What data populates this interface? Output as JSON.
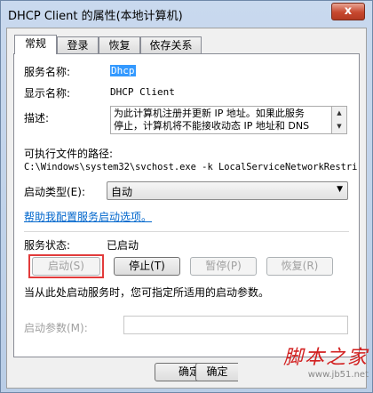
{
  "window": {
    "title": "DHCP Client 的属性(本地计算机)",
    "close_label": "x"
  },
  "tabs": [
    {
      "label": "常规",
      "active": true
    },
    {
      "label": "登录",
      "active": false
    },
    {
      "label": "恢复",
      "active": false
    },
    {
      "label": "依存关系",
      "active": false
    }
  ],
  "general": {
    "service_name_label": "服务名称:",
    "service_name_value": "Dhcp",
    "display_name_label": "显示名称:",
    "display_name_value": "DHCP Client",
    "description_label": "描述:",
    "description_line1": "为此计算机注册并更新 IP 地址。如果此服务",
    "description_line2": "停止，计算机将不能接收动态 IP 地址和 DNS",
    "exec_path_label": "可执行文件的路径:",
    "exec_path_value": "C:\\Windows\\system32\\svchost.exe -k LocalServiceNetworkRestri",
    "startup_type_label": "启动类型(E):",
    "startup_type_value": "自动",
    "help_link": "帮助我配置服务启动选项。",
    "status_label": "服务状态:",
    "status_value": "已启动",
    "start_button": "启动(S)",
    "stop_button": "停止(T)",
    "pause_button": "暂停(P)",
    "resume_button": "恢复(R)",
    "hint_text": "当从此处启动服务时，您可指定所适用的启动参数。",
    "start_params_label": "启动参数(M):",
    "start_params_value": ""
  },
  "footer": {
    "ok_button": "确定",
    "cancel_button": "确定"
  },
  "watermark": {
    "logo": "脚本之家",
    "url": "www.jb51.net"
  },
  "colors": {
    "highlight_box": "#e23b3b",
    "link": "#0066cc",
    "selection": "#3399ff",
    "close_button": "#c7482f"
  },
  "icons": {
    "close": "close-icon",
    "dropdown": "chevron-down-icon",
    "scroll_up": "arrow-up-icon",
    "scroll_down": "arrow-down-icon"
  }
}
